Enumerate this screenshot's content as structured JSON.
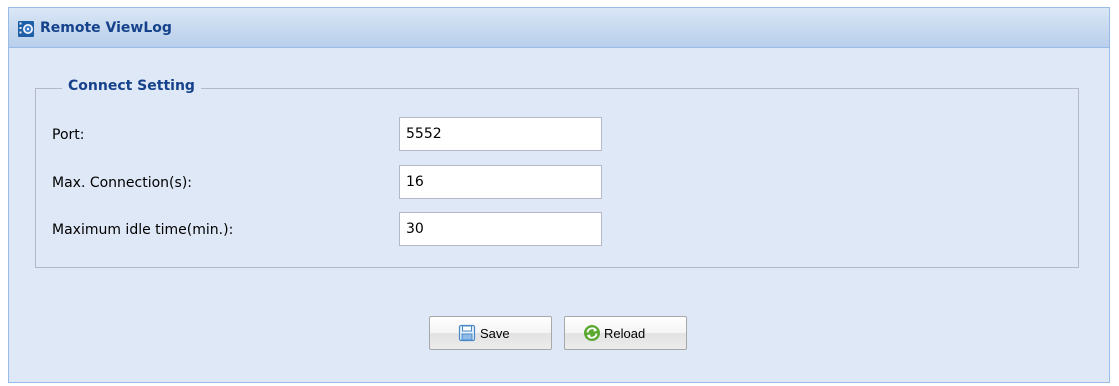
{
  "panel": {
    "title": "Remote ViewLog",
    "icon": "film-reel-icon"
  },
  "connect_setting": {
    "legend": "Connect Setting",
    "fields": [
      {
        "label": "Port:",
        "value": "5552"
      },
      {
        "label": "Max. Connection(s):",
        "value": "16"
      },
      {
        "label": "Maximum idle time(min.):",
        "value": "30"
      }
    ]
  },
  "buttons": {
    "save": {
      "label": "Save",
      "icon": "floppy-disk-icon"
    },
    "reload": {
      "label": "Reload",
      "icon": "refresh-arrows-icon"
    }
  },
  "colors": {
    "panel_background": "#dfe8f6",
    "header_text": "#15428b",
    "border": "#99bbe8",
    "field_border": "#b5b8c8"
  }
}
